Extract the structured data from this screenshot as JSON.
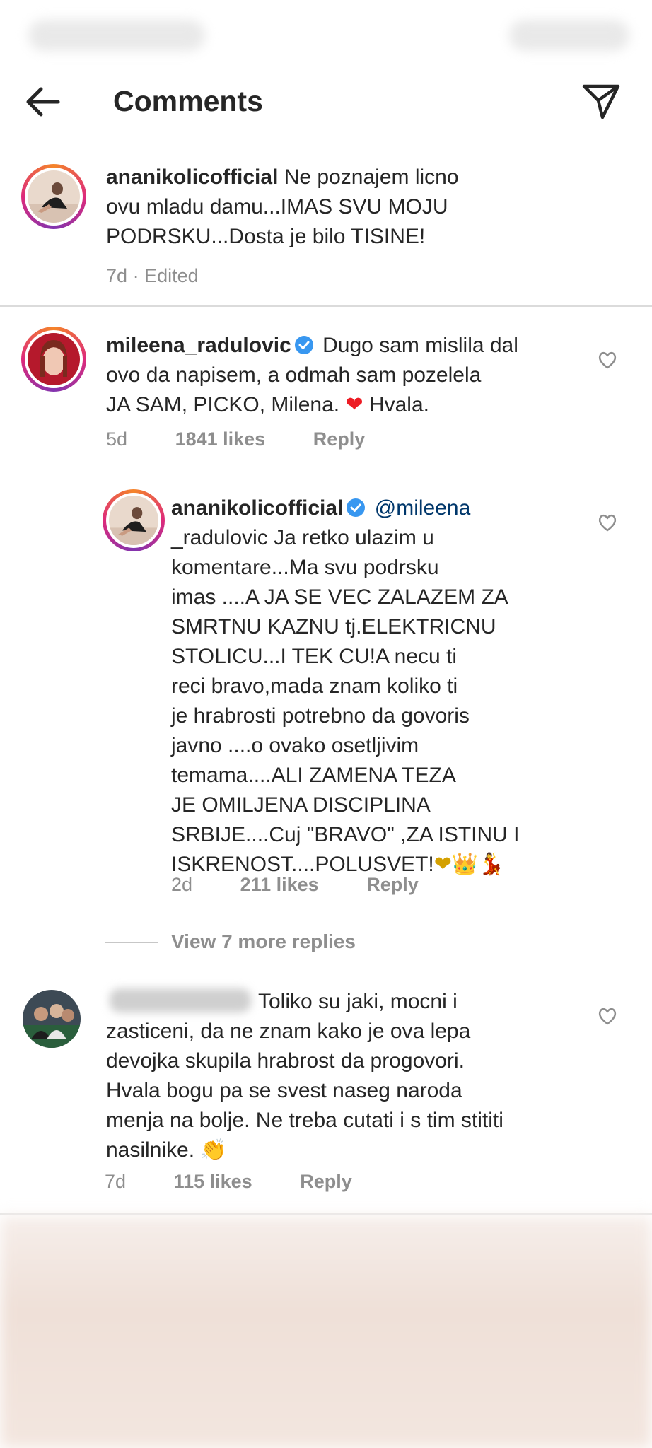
{
  "header": {
    "title": "Comments",
    "back_icon": "arrow-left-icon",
    "share_icon": "paper-plane-icon"
  },
  "comments": [
    {
      "username": "ananikolicofficial",
      "line1": "Ne poznajem licno",
      "line2": "ovu mladu damu...IMAS SVU MOJU",
      "line3": "PODRSKU...Dosta je bilo TISINE!",
      "time": "7d",
      "edited": "· Edited"
    },
    {
      "username": "mileena_radulovic",
      "verified": true,
      "line1": "Dugo sam mislila dal",
      "line2": "ovo da napisem, a odmah sam pozelela",
      "line3": "JA SAM, PICKO, Milena.",
      "line3_emoji": "❤",
      "line3_tail": "Hvala.",
      "time": "5d",
      "likes": "1841 likes",
      "reply": "Reply",
      "replies": [
        {
          "username": "ananikolicofficial",
          "verified": true,
          "mention_part1": "@mileena",
          "lines": [
            "_radulovic Ja retko ulazim u",
            "komentare...Ma svu podrsku",
            "imas ....A JA SE VEC ZALAZEM ZA",
            "SMRTNU KAZNU tj.ELEKTRICNU",
            "STOLICU...I TEK CU!A necu ti",
            "reci bravo,mada znam koliko ti",
            "je hrabrosti potrebno da govoris",
            "javno ....o ovako osetljivim",
            "temama....ALI ZAMENA TEZA",
            "JE OMILJENA DISCIPLINA",
            "SRBIJE....Cuj \"BRAVO\" ,ZA ISTINU I"
          ],
          "last_line": "ISKRENOST....POLUSVET!",
          "last_emojis": "❤👑💃",
          "time": "2d",
          "likes": "211 likes",
          "reply": "Reply"
        }
      ],
      "view_more": "View 7 more replies"
    },
    {
      "lines": [
        "Toliko su jaki, mocni i",
        "zasticeni, da ne znam kako je ova lepa",
        "devojka skupila hrabrost da progovori.",
        "Hvala bogu pa se svest naseg naroda",
        "menja na bolje. Ne treba cutati i s tim stititi"
      ],
      "last_line": "nasilnike.",
      "last_emoji": "👏",
      "time": "7d",
      "likes": "115 likes",
      "reply": "Reply"
    }
  ],
  "colors": {
    "text": "#262626",
    "meta": "#8e8e8e",
    "mention": "#00376b",
    "verified": "#3897f0",
    "heart": "#ed4956"
  }
}
